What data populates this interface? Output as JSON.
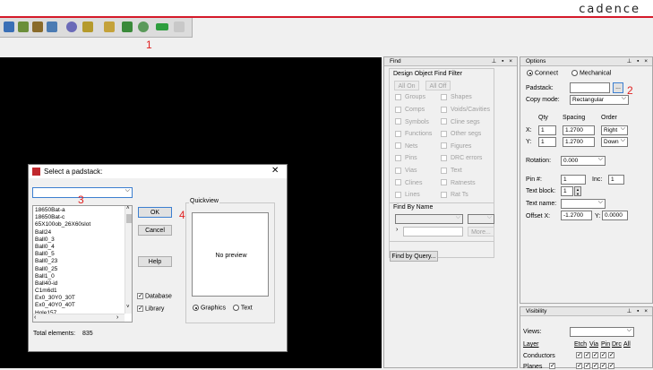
{
  "brand": "cadence",
  "annotations": [
    "1",
    "2",
    "3",
    "4"
  ],
  "toolbar": {
    "icons": [
      "help-icon",
      "info-icon",
      "layers-icon",
      "grid-icon",
      "select-icon",
      "ratsnest-icon",
      "counter-icon",
      "hourglass-icon",
      "globe-icon",
      "label-icon",
      "disabled-icon"
    ]
  },
  "find": {
    "title": "Find",
    "filter_title": "Design Object Find Filter",
    "all_on": "All On",
    "all_off": "All Off",
    "left": [
      "Groups",
      "Comps",
      "Symbols",
      "Functions",
      "Nets",
      "Pins",
      "Vias",
      "Clines",
      "Lines"
    ],
    "right": [
      "Shapes",
      "Voids/Cavities",
      "Cline segs",
      "Other segs",
      "Figures",
      "DRC errors",
      "Text",
      "Ratnests",
      "Rat Ts"
    ],
    "by_name_title": "Find By Name",
    "more": "More...",
    "by_query": "Find by Query..."
  },
  "options": {
    "title": "Options",
    "connect": "Connect",
    "mechanical": "Mechanical",
    "padstack_label": "Padstack:",
    "padstack_value": "",
    "browse": "...",
    "copy_mode_label": "Copy mode:",
    "copy_mode_value": "Rectangular",
    "qty_header": "Qty",
    "spacing_header": "Spacing",
    "order_header": "Order",
    "x_label": "X:",
    "y_label": "Y:",
    "x_qty": "1",
    "y_qty": "1",
    "x_spacing": "1.2700",
    "y_spacing": "1.2700",
    "x_order": "Right",
    "y_order": "Down",
    "rotation_label": "Rotation:",
    "rotation_value": "0.000",
    "pin_label": "Pin #:",
    "pin_value": "1",
    "inc_label": "Inc:",
    "inc_value": "1",
    "textblock_label": "Text block:",
    "textblock_value": "1",
    "textname_label": "Text name:",
    "textname_value": "",
    "offset_label": "Offset X:",
    "offset_x": "-1.2700",
    "offset_y_label": "Y:",
    "offset_y": "0.0000"
  },
  "visibility": {
    "title": "Visibility",
    "views_label": "Views:",
    "layer_header": "Layer",
    "cols": [
      "Etch",
      "Via",
      "Pin",
      "Drc",
      "All"
    ],
    "rows": [
      "Conductors",
      "Planes"
    ]
  },
  "dialog": {
    "title": "Select a padstack:",
    "combo_value": "",
    "items": [
      "18650Bat-a",
      "18650Bat-c",
      "65X100ob_26X60slot",
      "Ball24",
      "Ball0_3",
      "Ball0_4",
      "Ball0_5",
      "Ball0_23",
      "Ball0_25",
      "Ball1_0",
      "Ball40-id",
      "C1m6d1",
      "Ex0_30Y0_30T",
      "Ex0_40Y0_40T",
      "Hole157"
    ],
    "ok": "OK",
    "cancel": "Cancel",
    "help": "Help",
    "quickview": "Quickview",
    "no_preview": "No preview",
    "database": "Database",
    "library": "Library",
    "graphics": "Graphics",
    "text": "Text",
    "total_label": "Total elements:",
    "total_value": "835"
  },
  "colors": {
    "accent_red": "#d51a2a",
    "annotation_red": "#e02020",
    "canvas": "#000000"
  }
}
